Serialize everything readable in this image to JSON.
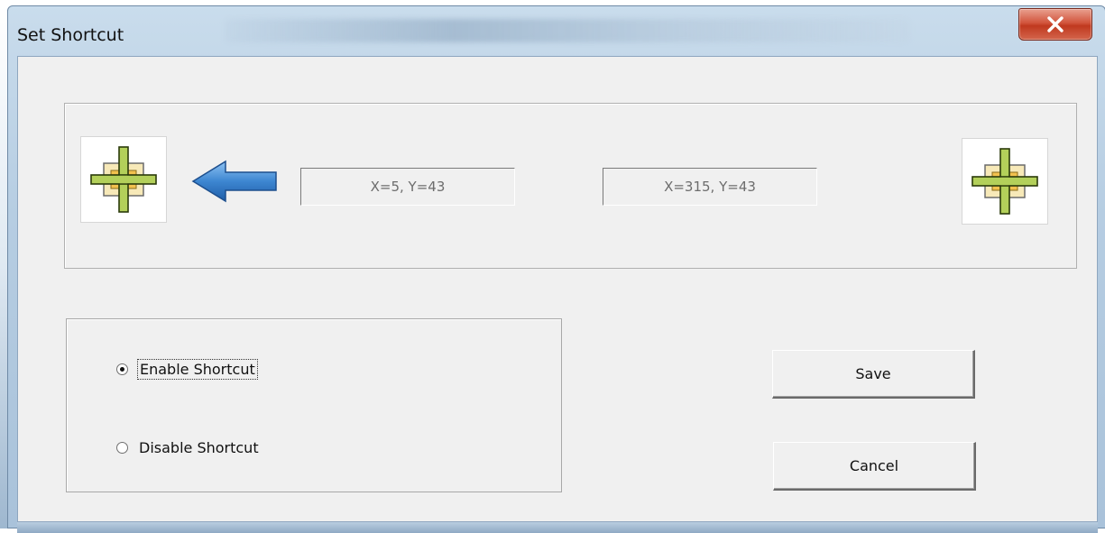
{
  "window": {
    "title": "Set Shortcut",
    "close_icon": "close-x-icon"
  },
  "coords": {
    "left_value": "X=5, Y=43",
    "right_value": "X=315, Y=43"
  },
  "icons": {
    "left_target": "crosshair-target-icon",
    "arrow": "arrow-left-icon",
    "right_target": "crosshair-target-icon"
  },
  "options": {
    "enable_label": "Enable Shortcut",
    "disable_label": "Disable Shortcut",
    "selected": "enable"
  },
  "buttons": {
    "save_label": "Save",
    "cancel_label": "Cancel"
  },
  "colors": {
    "close_button": "#c9432a",
    "arrow": "#2f6fb8",
    "crosshair": "#a9c94a",
    "crosshair_center": "#f2c14e"
  }
}
